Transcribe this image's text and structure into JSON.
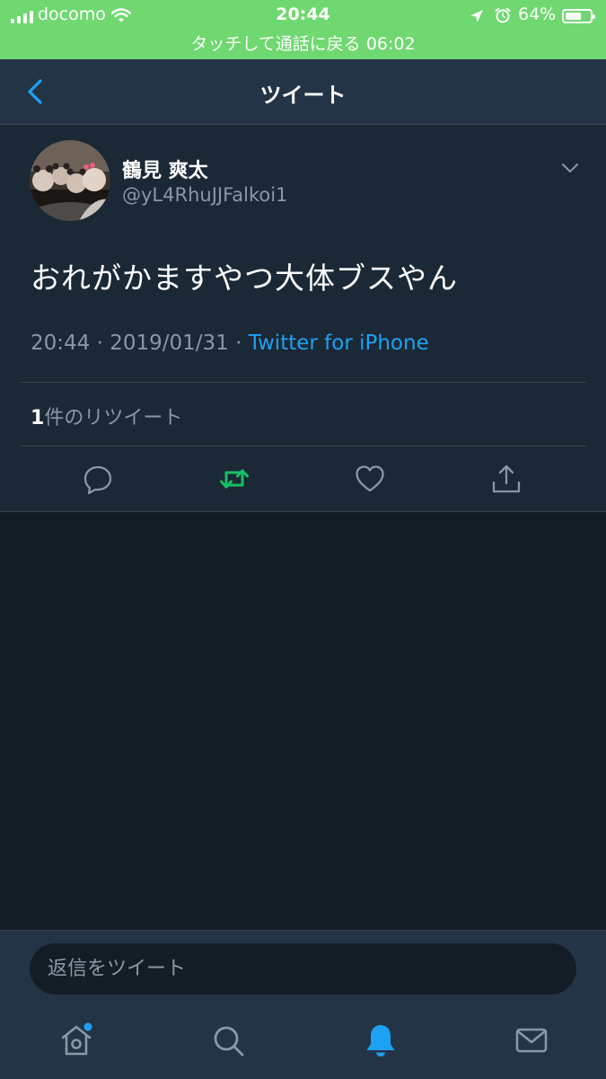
{
  "status_bar": {
    "carrier": "docomo",
    "time": "20:44",
    "battery_percent_label": "64%",
    "battery_level": 0.64,
    "call_banner": "タッチして通話に戻る 06:02"
  },
  "nav": {
    "title": "ツイート"
  },
  "tweet": {
    "author_name": "鶴見 爽太",
    "author_handle": "@yL4RhuJJFalkoi1",
    "text": "おれがかますやつ大体ブスやん",
    "time": "20:44",
    "date": "2019/01/31",
    "separator": "·",
    "source": "Twitter for iPhone",
    "retweet_count": "1",
    "retweet_label": "件のリツイート"
  },
  "colors": {
    "status_bar_bg": "#6fd870",
    "nav_bg": "#243447",
    "tweet_bg": "#1b2836",
    "page_bg": "#141d26",
    "accent": "#1da1f2",
    "retweet_active": "#17bf63",
    "muted": "#8899a6"
  },
  "composer": {
    "placeholder": "返信をツイート"
  },
  "tab_bar": {
    "items": [
      "home-icon",
      "search-icon",
      "notifications-icon",
      "messages-icon"
    ],
    "active": "notifications-icon",
    "home_has_badge": true
  }
}
